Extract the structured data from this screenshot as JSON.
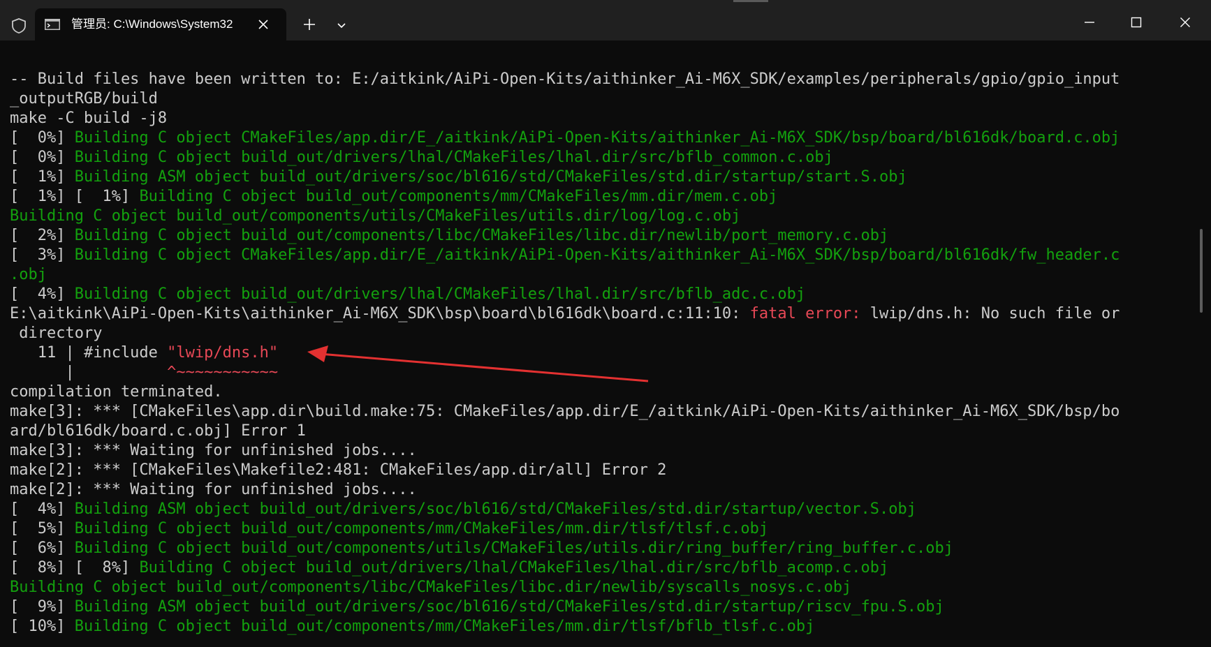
{
  "titlebar": {
    "tab_title": "管理员: C:\\Windows\\System32",
    "icons": {
      "shield": "shield-icon",
      "terminal": "terminal-icon",
      "close_tab": "close-icon",
      "new_tab": "plus-icon",
      "dropdown": "chevron-down-icon",
      "minimize": "minimize-icon",
      "maximize": "maximize-icon",
      "close_window": "close-icon"
    }
  },
  "colors": {
    "background": "#0c0c0c",
    "titlebar": "#202020",
    "text": "#cccccc",
    "green": "#13a10e",
    "red": "#e74856"
  },
  "terminal": {
    "lines": [
      {
        "segments": [
          {
            "text": "-- Build files have been written to: E:/aitkink/AiPi-Open-Kits/aithinker_Ai-M6X_SDK/examples/peripherals/gpio/gpio_input",
            "color": "w"
          }
        ]
      },
      {
        "segments": [
          {
            "text": "_outputRGB/build",
            "color": "w"
          }
        ]
      },
      {
        "segments": [
          {
            "text": "make -C build -j8",
            "color": "w"
          }
        ]
      },
      {
        "segments": [
          {
            "text": "[  0%] ",
            "color": "w"
          },
          {
            "text": "Building C object CMakeFiles/app.dir/E_/aitkink/AiPi-Open-Kits/aithinker_Ai-M6X_SDK/bsp/board/bl616dk/board.c.obj",
            "color": "g"
          }
        ]
      },
      {
        "segments": [
          {
            "text": "[  0%] ",
            "color": "w"
          },
          {
            "text": "Building C object build_out/drivers/lhal/CMakeFiles/lhal.dir/src/bflb_common.c.obj",
            "color": "g"
          }
        ]
      },
      {
        "segments": [
          {
            "text": "[  1%] ",
            "color": "w"
          },
          {
            "text": "Building ASM object build_out/drivers/soc/bl616/std/CMakeFiles/std.dir/startup/start.S.obj",
            "color": "g"
          }
        ]
      },
      {
        "segments": [
          {
            "text": "[  1%] [  1%] ",
            "color": "w"
          },
          {
            "text": "Building C object build_out/components/mm/CMakeFiles/mm.dir/mem.c.obj",
            "color": "g"
          }
        ]
      },
      {
        "segments": [
          {
            "text": "Building C object build_out/components/utils/CMakeFiles/utils.dir/log/log.c.obj",
            "color": "g"
          }
        ]
      },
      {
        "segments": [
          {
            "text": "[  2%] ",
            "color": "w"
          },
          {
            "text": "Building C object build_out/components/libc/CMakeFiles/libc.dir/newlib/port_memory.c.obj",
            "color": "g"
          }
        ]
      },
      {
        "segments": [
          {
            "text": "[  3%] ",
            "color": "w"
          },
          {
            "text": "Building C object CMakeFiles/app.dir/E_/aitkink/AiPi-Open-Kits/aithinker_Ai-M6X_SDK/bsp/board/bl616dk/fw_header.c",
            "color": "g"
          }
        ]
      },
      {
        "segments": [
          {
            "text": ".obj",
            "color": "g"
          }
        ]
      },
      {
        "segments": [
          {
            "text": "[  4%] ",
            "color": "w"
          },
          {
            "text": "Building C object build_out/drivers/lhal/CMakeFiles/lhal.dir/src/bflb_adc.c.obj",
            "color": "g"
          }
        ]
      },
      {
        "segments": [
          {
            "text": "E:\\aitkink\\AiPi-Open-Kits\\aithinker_Ai-M6X_SDK\\bsp\\board\\bl616dk\\board.c:11:10: ",
            "color": "w"
          },
          {
            "text": "fatal error: ",
            "color": "r"
          },
          {
            "text": "lwip/dns.h: No such file or",
            "color": "w"
          }
        ]
      },
      {
        "segments": [
          {
            "text": " directory",
            "color": "w"
          }
        ]
      },
      {
        "segments": [
          {
            "text": "   11 | #include ",
            "color": "w"
          },
          {
            "text": "\"lwip/dns.h\"",
            "color": "r"
          }
        ]
      },
      {
        "segments": [
          {
            "text": "      |          ",
            "color": "w"
          },
          {
            "text": "^~~~~~~~~~~~",
            "color": "r"
          }
        ]
      },
      {
        "segments": [
          {
            "text": "compilation terminated.",
            "color": "w"
          }
        ]
      },
      {
        "segments": [
          {
            "text": "make[3]: *** [CMakeFiles\\app.dir\\build.make:75: CMakeFiles/app.dir/E_/aitkink/AiPi-Open-Kits/aithinker_Ai-M6X_SDK/bsp/bo",
            "color": "w"
          }
        ]
      },
      {
        "segments": [
          {
            "text": "ard/bl616dk/board.c.obj] Error 1",
            "color": "w"
          }
        ]
      },
      {
        "segments": [
          {
            "text": "make[3]: *** Waiting for unfinished jobs....",
            "color": "w"
          }
        ]
      },
      {
        "segments": [
          {
            "text": "make[2]: *** [CMakeFiles\\Makefile2:481: CMakeFiles/app.dir/all] Error 2",
            "color": "w"
          }
        ]
      },
      {
        "segments": [
          {
            "text": "make[2]: *** Waiting for unfinished jobs....",
            "color": "w"
          }
        ]
      },
      {
        "segments": [
          {
            "text": "[  4%] ",
            "color": "w"
          },
          {
            "text": "Building ASM object build_out/drivers/soc/bl616/std/CMakeFiles/std.dir/startup/vector.S.obj",
            "color": "g"
          }
        ]
      },
      {
        "segments": [
          {
            "text": "[  5%] ",
            "color": "w"
          },
          {
            "text": "Building C object build_out/components/mm/CMakeFiles/mm.dir/tlsf/tlsf.c.obj",
            "color": "g"
          }
        ]
      },
      {
        "segments": [
          {
            "text": "[  6%] ",
            "color": "w"
          },
          {
            "text": "Building C object build_out/components/utils/CMakeFiles/utils.dir/ring_buffer/ring_buffer.c.obj",
            "color": "g"
          }
        ]
      },
      {
        "segments": [
          {
            "text": "[  8%] [  8%] ",
            "color": "w"
          },
          {
            "text": "Building C object build_out/drivers/lhal/CMakeFiles/lhal.dir/src/bflb_acomp.c.obj",
            "color": "g"
          }
        ]
      },
      {
        "segments": [
          {
            "text": "Building C object build_out/components/libc/CMakeFiles/libc.dir/newlib/syscalls_nosys.c.obj",
            "color": "g"
          }
        ]
      },
      {
        "segments": [
          {
            "text": "[  9%] ",
            "color": "w"
          },
          {
            "text": "Building ASM object build_out/drivers/soc/bl616/std/CMakeFiles/std.dir/startup/riscv_fpu.S.obj",
            "color": "g"
          }
        ]
      },
      {
        "segments": [
          {
            "text": "[ 10%] ",
            "color": "w"
          },
          {
            "text": "Building C object build_out/components/mm/CMakeFiles/mm.dir/tlsf/bflb_tlsf.c.obj",
            "color": "g"
          }
        ]
      }
    ]
  }
}
